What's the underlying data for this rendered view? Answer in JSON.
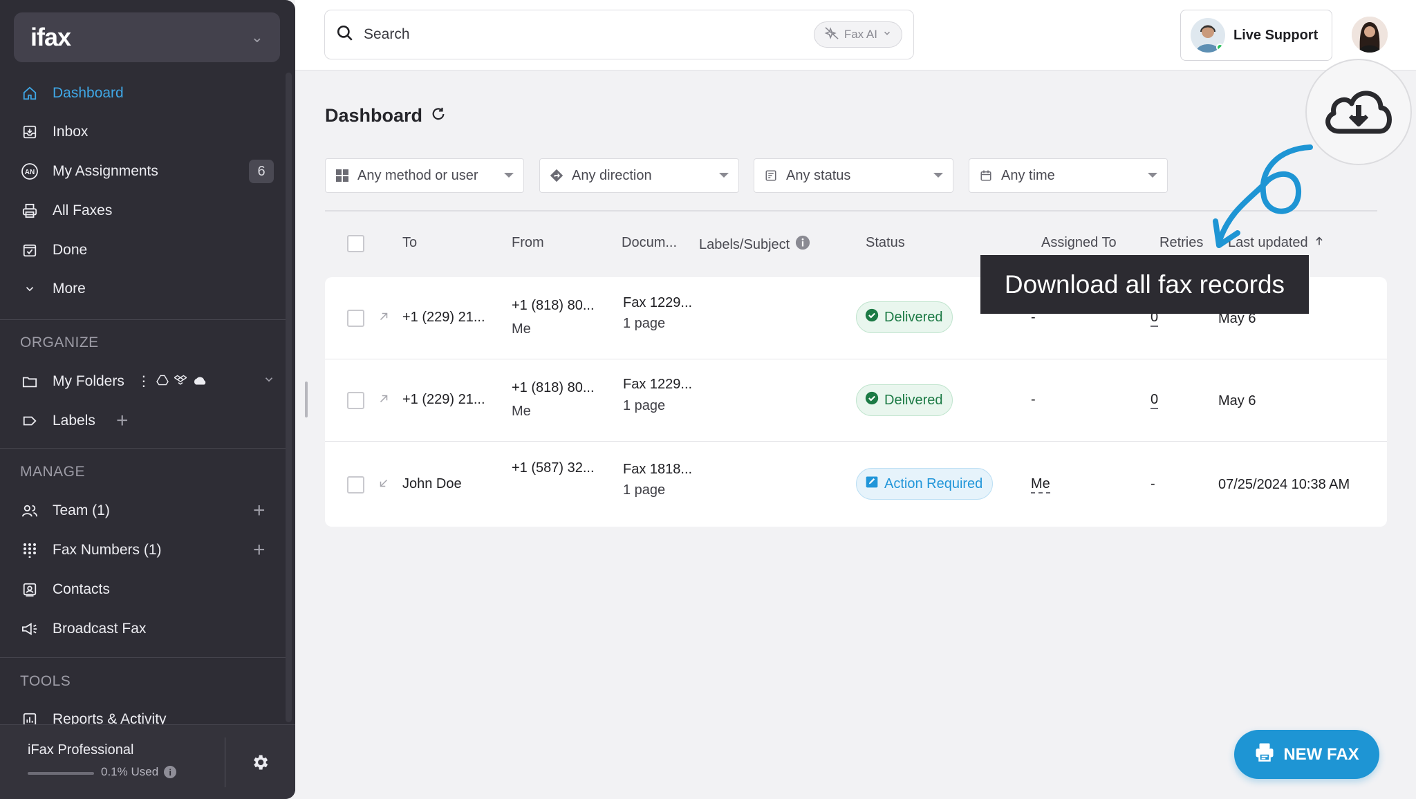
{
  "sidebar": {
    "brand": "ifax",
    "nav": [
      {
        "label": "Dashboard",
        "icon": "home-icon",
        "active": true
      },
      {
        "label": "Inbox",
        "icon": "inbox-icon"
      },
      {
        "label": "My Assignments",
        "icon": "assignments-icon",
        "badge": "6"
      },
      {
        "label": "All Faxes",
        "icon": "printer-icon"
      },
      {
        "label": "Done",
        "icon": "done-icon"
      },
      {
        "label": "More",
        "icon": "chevron-down-icon"
      }
    ],
    "organize_label": "ORGANIZE",
    "organize": [
      {
        "label": "My Folders",
        "icon": "folder-icon"
      },
      {
        "label": "Labels",
        "icon": "label-icon"
      }
    ],
    "manage_label": "MANAGE",
    "manage": [
      {
        "label": "Team (1)",
        "icon": "team-icon"
      },
      {
        "label": "Fax Numbers (1)",
        "icon": "dialpad-icon"
      },
      {
        "label": "Contacts",
        "icon": "contacts-icon"
      },
      {
        "label": "Broadcast Fax",
        "icon": "megaphone-icon"
      }
    ],
    "tools_label": "TOOLS",
    "tools": [
      {
        "label": "Reports & Activity",
        "icon": "reports-icon"
      }
    ],
    "footer": {
      "plan": "iFax Professional",
      "usage_text": "0.1% Used",
      "usage_fraction": 0.001
    }
  },
  "topbar": {
    "search_placeholder": "Search",
    "faxai_label": "Fax AI",
    "live_support": "Live Support"
  },
  "main": {
    "title": "Dashboard",
    "filters": [
      {
        "label": "Any method or user",
        "icon": "grid-icon"
      },
      {
        "label": "Any direction",
        "icon": "direction-icon"
      },
      {
        "label": "Any status",
        "icon": "status-icon"
      },
      {
        "label": "Any time",
        "icon": "calendar-icon"
      }
    ],
    "columns": [
      "To",
      "From",
      "Docum...",
      "Labels/Subject",
      "Status",
      "Assigned To",
      "Retries",
      "Last updated"
    ],
    "rows": [
      {
        "to": "+1 (229) 21...",
        "from": "+1 (818) 80...",
        "from_sub": "Me",
        "doc": "Fax 1229...",
        "doc_sub": "1 page",
        "status": "Delivered",
        "assigned": "-",
        "retries": "0",
        "updated": "May 6",
        "direction": "outgoing"
      },
      {
        "to": "+1 (229) 21...",
        "from": "+1 (818) 80...",
        "from_sub": "Me",
        "doc": "Fax 1229...",
        "doc_sub": "1 page",
        "status": "Delivered",
        "assigned": "-",
        "retries": "0",
        "updated": "May 6",
        "direction": "outgoing"
      },
      {
        "to": "John Doe",
        "from": "+1 (587) 32...",
        "from_sub": "",
        "doc": "Fax 1818...",
        "doc_sub": "1 page",
        "status": "Action Required",
        "assigned": "Me",
        "retries": "-",
        "updated": "07/25/2024 10:38 AM",
        "direction": "incoming"
      }
    ]
  },
  "tooltip": "Download all fax records",
  "annotation_number": "6",
  "new_fax": "NEW FAX",
  "colors": {
    "accent": "#1e95d4",
    "sidebar": "#2e2d35",
    "delivered": "#1c7a45",
    "action": "#2196d9"
  }
}
